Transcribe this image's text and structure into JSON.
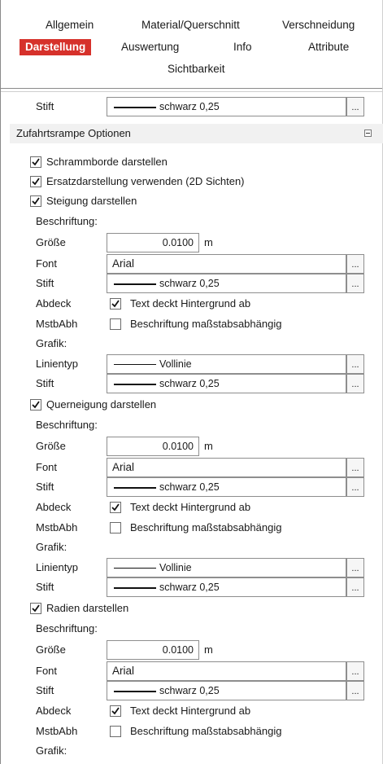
{
  "tabs": {
    "row1": [
      "Allgemein",
      "Material/Querschnitt",
      "Verschneidung"
    ],
    "row2": [
      "Darstellung",
      "Auswertung",
      "Info",
      "Attribute"
    ],
    "row3": [
      "Sichtbarkeit"
    ],
    "active": "Darstellung",
    "active_color": "#d6312b"
  },
  "top": {
    "stift_label": "Stift",
    "stift_value": "schwarz 0,25",
    "browse": "..."
  },
  "section": {
    "title": "Zufahrtsrampe Optionen"
  },
  "checks": {
    "schramm": "Schrammborde darstellen",
    "ersatz": "Ersatzdarstellung verwenden (2D Sichten)",
    "steigung": "Steigung darstellen",
    "querneigung": "Querneigung darstellen",
    "radien": "Radien darstellen"
  },
  "common": {
    "beschriftung": "Beschriftung:",
    "groesse": "Größe",
    "font": "Font",
    "stift": "Stift",
    "abdeck": "Abdeck",
    "mstbabh": "MstbAbh",
    "grafik": "Grafik:",
    "linientyp": "Linientyp",
    "size_value": "0.0100",
    "unit": "m",
    "font_value": "Arial",
    "pen_value": "schwarz 0,25",
    "linetype_value": "Vollinie",
    "abdeck_text": "Text deckt Hintergrund ab",
    "mstbabh_text": "Beschriftung maßstabsabhängig",
    "browse": "..."
  }
}
